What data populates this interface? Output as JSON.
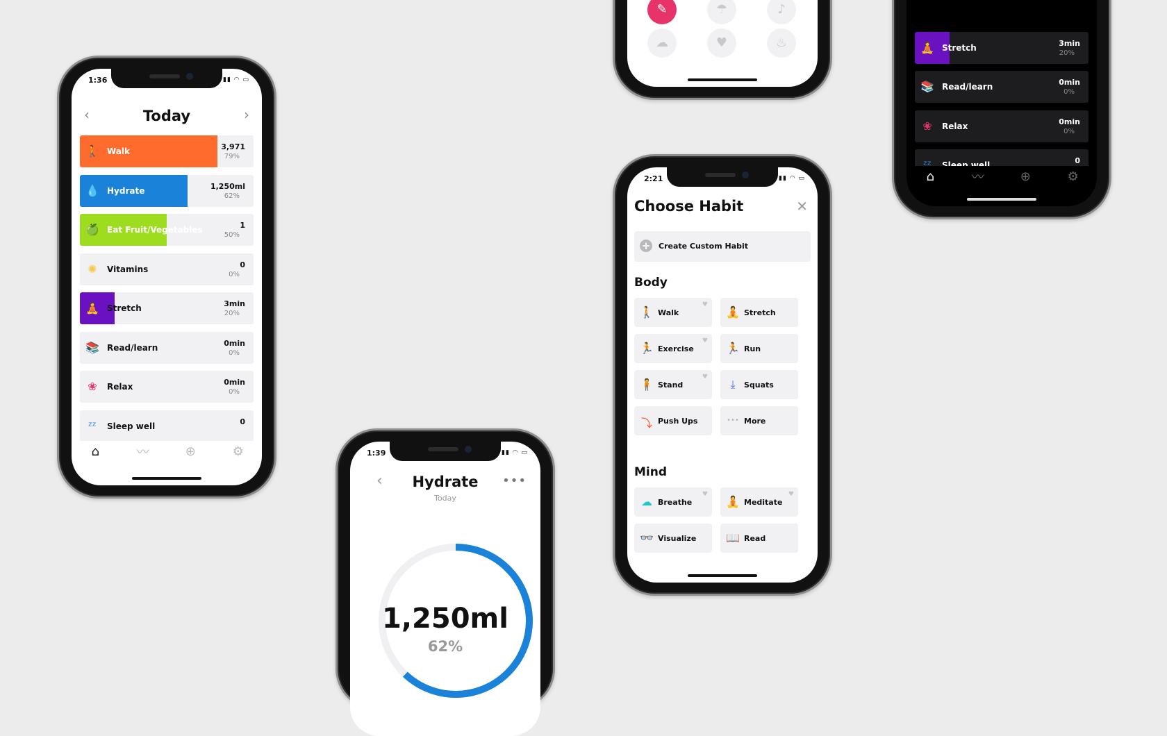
{
  "colors": {
    "background": "#ececec",
    "walk": "#ff6b2c",
    "hydrate": "#1a82d8",
    "fruit": "#9ddc1e",
    "stretch": "#6a11c2",
    "accent": "#e8326a"
  },
  "phone_today": {
    "time": "1:36",
    "title": "Today",
    "prev_icon": "chevron-left-icon",
    "next_icon": "chevron-right-icon",
    "habits": [
      {
        "label": "Walk",
        "value": "3,971",
        "pct": "79%",
        "progress": 0.79,
        "color": "#ff6b2c",
        "icon": "walk-icon"
      },
      {
        "label": "Hydrate",
        "value": "1,250ml",
        "pct": "62%",
        "progress": 0.62,
        "color": "#1a82d8",
        "icon": "drop-icon"
      },
      {
        "label": "Eat Fruit/Vegetables",
        "value": "1",
        "pct": "50%",
        "progress": 0.5,
        "color": "#9ddc1e",
        "icon": "apple-icon"
      },
      {
        "label": "Vitamins",
        "value": "0",
        "pct": "0%",
        "progress": 0,
        "color": "#f6c945",
        "icon": "citrus-icon"
      },
      {
        "label": "Stretch",
        "value": "3min",
        "pct": "20%",
        "progress": 0.2,
        "color": "#6a11c2",
        "icon": "stretch-icon"
      },
      {
        "label": "Read/learn",
        "value": "0min",
        "pct": "0%",
        "progress": 0,
        "color": "#f36b2a",
        "icon": "books-icon"
      },
      {
        "label": "Relax",
        "value": "0min",
        "pct": "0%",
        "progress": 0,
        "color": "#e8326a",
        "icon": "lotus-icon"
      },
      {
        "label": "Sleep well",
        "value": "0",
        "pct": "",
        "progress": 0,
        "color": "#2e86de",
        "icon": "sleep-icon"
      }
    ],
    "tabs": [
      "home-icon",
      "trends-icon",
      "add-icon",
      "settings-icon"
    ]
  },
  "phone_hydrate": {
    "time": "1:39",
    "title": "Hydrate",
    "subtitle": "Today",
    "amount": "1,250ml",
    "percent": "62%",
    "progress": 0.62
  },
  "phone_choose": {
    "time": "2:21",
    "title": "Choose Habit",
    "create_label": "Create Custom Habit",
    "body_heading": "Body",
    "mind_heading": "Mind",
    "body_items": [
      {
        "label": "Walk",
        "icon": "walk-icon",
        "color": "#ff6b2c",
        "fav": true
      },
      {
        "label": "Stretch",
        "icon": "stretch-icon",
        "color": "#5b3ee0",
        "fav": false
      },
      {
        "label": "Exercise",
        "icon": "exercise-icon",
        "color": "#3cc96a",
        "fav": true
      },
      {
        "label": "Run",
        "icon": "run-icon",
        "color": "#e8326a",
        "fav": false
      },
      {
        "label": "Stand",
        "icon": "stand-icon",
        "color": "#3a3f5c",
        "fav": true
      },
      {
        "label": "Squats",
        "icon": "squats-icon",
        "color": "#3d6bf0",
        "fav": false
      },
      {
        "label": "Push Ups",
        "icon": "pushups-icon",
        "color": "#ff4d1f",
        "fav": false
      },
      {
        "label": "More",
        "icon": "more-icon",
        "color": "#b5b5b5",
        "fav": false
      }
    ],
    "mind_items": [
      {
        "label": "Breathe",
        "icon": "breathe-icon",
        "color": "#20c7c9",
        "fav": true
      },
      {
        "label": "Meditate",
        "icon": "meditate-icon",
        "color": "#3cc96a",
        "fav": true
      },
      {
        "label": "Visualize",
        "icon": "visualize-icon",
        "color": "#3cc96a",
        "fav": false
      },
      {
        "label": "Read",
        "icon": "read-icon",
        "color": "#a0602c",
        "fav": false
      }
    ]
  },
  "phone_icons": {
    "icons": [
      {
        "icon": "brush-icon",
        "active": true
      },
      {
        "icon": "palm-icon",
        "active": false
      },
      {
        "icon": "music-icon",
        "active": false
      },
      {
        "icon": "cloud-icon",
        "active": false
      },
      {
        "icon": "heartbeat-icon",
        "active": false
      },
      {
        "icon": "fire-icon",
        "active": false
      }
    ]
  },
  "phone_dark": {
    "habits": [
      {
        "label": "",
        "value": "",
        "pct": "",
        "progress": 0,
        "color": "#1d1d1f",
        "icon": ""
      },
      {
        "label": "Stretch",
        "value": "3min",
        "pct": "20%",
        "progress": 0.2,
        "color": "#6a11c2",
        "icon": "stretch-icon"
      },
      {
        "label": "Read/learn",
        "value": "0min",
        "pct": "0%",
        "progress": 0,
        "color": "#f36b2a",
        "icon": "books-icon"
      },
      {
        "label": "Relax",
        "value": "0min",
        "pct": "0%",
        "progress": 0,
        "color": "#e8326a",
        "icon": "lotus-icon"
      },
      {
        "label": "Sleep well",
        "value": "0",
        "pct": "",
        "progress": 0,
        "color": "#2e86de",
        "icon": "sleep-icon"
      }
    ],
    "tabs": [
      "home-icon",
      "trends-icon",
      "add-icon",
      "settings-icon"
    ]
  }
}
